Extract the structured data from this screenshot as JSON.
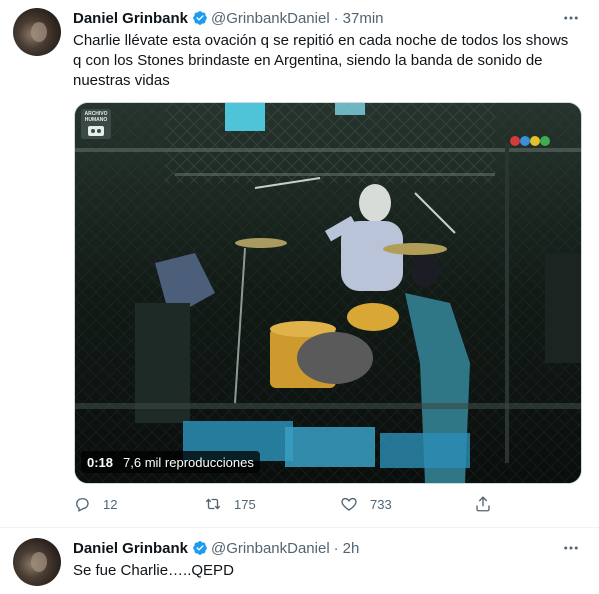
{
  "tweets": [
    {
      "name": "Daniel Grinbank",
      "handle": "@GrinbankDaniel",
      "separator": "·",
      "time": "37min",
      "text": "Charlie llévate esta ovación q se repitió en cada noche de todos los shows q con los Stones brindaste en Argentina, siendo la banda de sonido de nuestras vidas",
      "video": {
        "watermark": "ARCHIVO\nHUMANO",
        "duration": "0:18",
        "views": "7,6 mil reproducciones"
      },
      "actions": {
        "replies": "12",
        "retweets": "175",
        "likes": "733"
      }
    },
    {
      "name": "Daniel Grinbank",
      "handle": "@GrinbankDaniel",
      "separator": "·",
      "time": "2h",
      "text": "Se fue Charlie…..QEPD"
    }
  ],
  "colors": {
    "text": "#0f1419",
    "secondary": "#536471",
    "verified": "#1d9bf0",
    "divider": "#eff3f4"
  },
  "icons": [
    "verified-badge-icon",
    "more-icon",
    "reply-icon",
    "retweet-icon",
    "like-icon",
    "share-icon"
  ]
}
